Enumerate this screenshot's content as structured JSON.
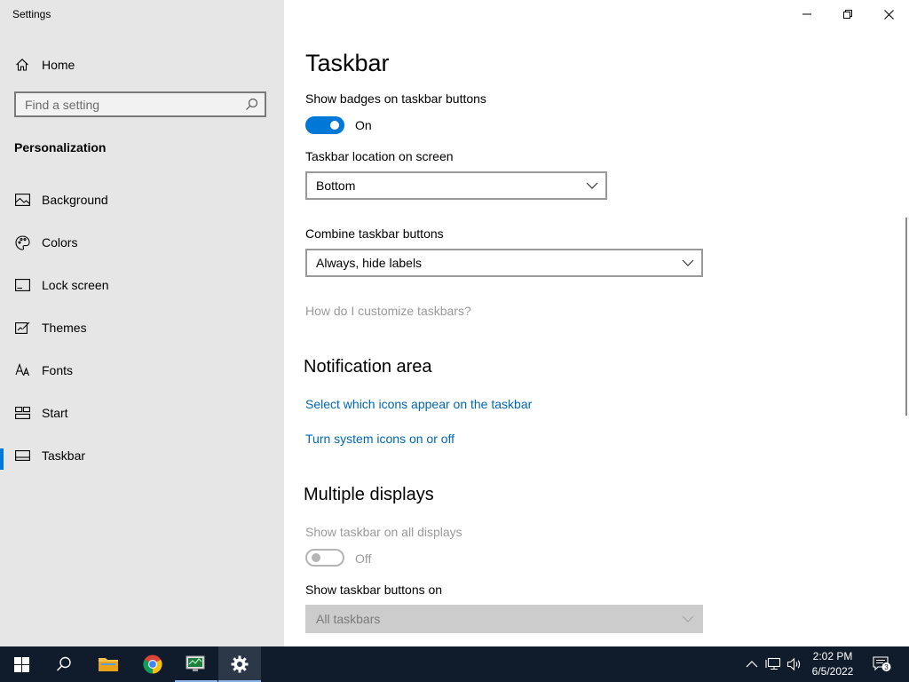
{
  "window": {
    "app_title": "Settings"
  },
  "sidebar": {
    "home_label": "Home",
    "search": {
      "placeholder": "Find a setting",
      "value": ""
    },
    "section_heading": "Personalization",
    "items": [
      {
        "label": "Background",
        "icon": "image-icon",
        "selected": false
      },
      {
        "label": "Colors",
        "icon": "palette-icon",
        "selected": false
      },
      {
        "label": "Lock screen",
        "icon": "lock-screen-icon",
        "selected": false
      },
      {
        "label": "Themes",
        "icon": "themes-icon",
        "selected": false
      },
      {
        "label": "Fonts",
        "icon": "fonts-icon",
        "selected": false
      },
      {
        "label": "Start",
        "icon": "start-icon",
        "selected": false
      },
      {
        "label": "Taskbar",
        "icon": "taskbar-icon",
        "selected": true
      }
    ]
  },
  "main": {
    "title": "Taskbar",
    "badges": {
      "label": "Show badges on taskbar buttons",
      "state": "On",
      "on": true
    },
    "location": {
      "label": "Taskbar location on screen",
      "value": "Bottom"
    },
    "combine": {
      "label": "Combine taskbar buttons",
      "value": "Always, hide labels"
    },
    "help_link": "How do I customize taskbars?",
    "notification_area": {
      "heading": "Notification area",
      "link_icons": "Select which icons appear on the taskbar",
      "link_system_icons": "Turn system icons on or off"
    },
    "multiple_displays": {
      "heading": "Multiple displays",
      "show_all_label": "Show taskbar on all displays",
      "show_all_state": "Off",
      "show_all_on": false,
      "buttons_on_label": "Show taskbar buttons on",
      "buttons_on_value": "All taskbars"
    }
  },
  "taskbar": {
    "clock_time": "2:02 PM",
    "clock_date": "6/5/2022",
    "notification_count": "3",
    "colors": {
      "accent": "#0078d7",
      "taskbar_bg": "#101c2c",
      "link": "#0067b8"
    }
  }
}
